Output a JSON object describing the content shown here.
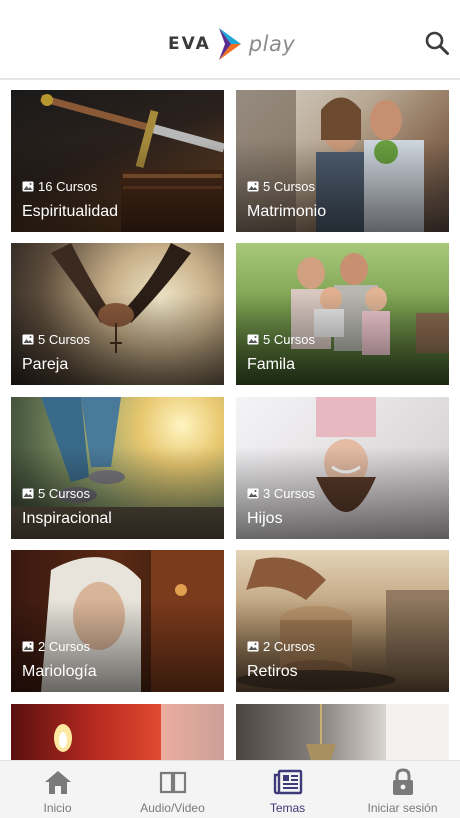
{
  "header": {
    "logo_text_left": "EVA",
    "logo_text_right": "play",
    "search_icon": "search-icon"
  },
  "colors": {
    "brand_orange": "#f37021",
    "brand_purple": "#5b2d8e",
    "brand_blue": "#1fa7d6",
    "nav_active": "#3f3a7a",
    "nav_inactive": "#7a7a7a"
  },
  "categories": [
    {
      "title": "Espiritualidad",
      "count": "16 Cursos"
    },
    {
      "title": "Matrimonio",
      "count": "5 Cursos"
    },
    {
      "title": "Pareja",
      "count": "5 Cursos"
    },
    {
      "title": "Famila",
      "count": "5 Cursos"
    },
    {
      "title": "Inspiracional",
      "count": "5 Cursos"
    },
    {
      "title": "Hijos",
      "count": "3 Cursos"
    },
    {
      "title": "Mariología",
      "count": "2 Cursos"
    },
    {
      "title": "Retiros",
      "count": "2 Cursos"
    },
    {
      "title": "",
      "count": ""
    },
    {
      "title": "",
      "count": ""
    }
  ],
  "bottom_nav": [
    {
      "label": "Inicio",
      "icon": "home-icon",
      "active": false
    },
    {
      "label": "Audio/Video",
      "icon": "book-icon",
      "active": false
    },
    {
      "label": "Temas",
      "icon": "newspaper-icon",
      "active": true
    },
    {
      "label": "Iniciar sesión",
      "icon": "lock-icon",
      "active": false
    }
  ]
}
